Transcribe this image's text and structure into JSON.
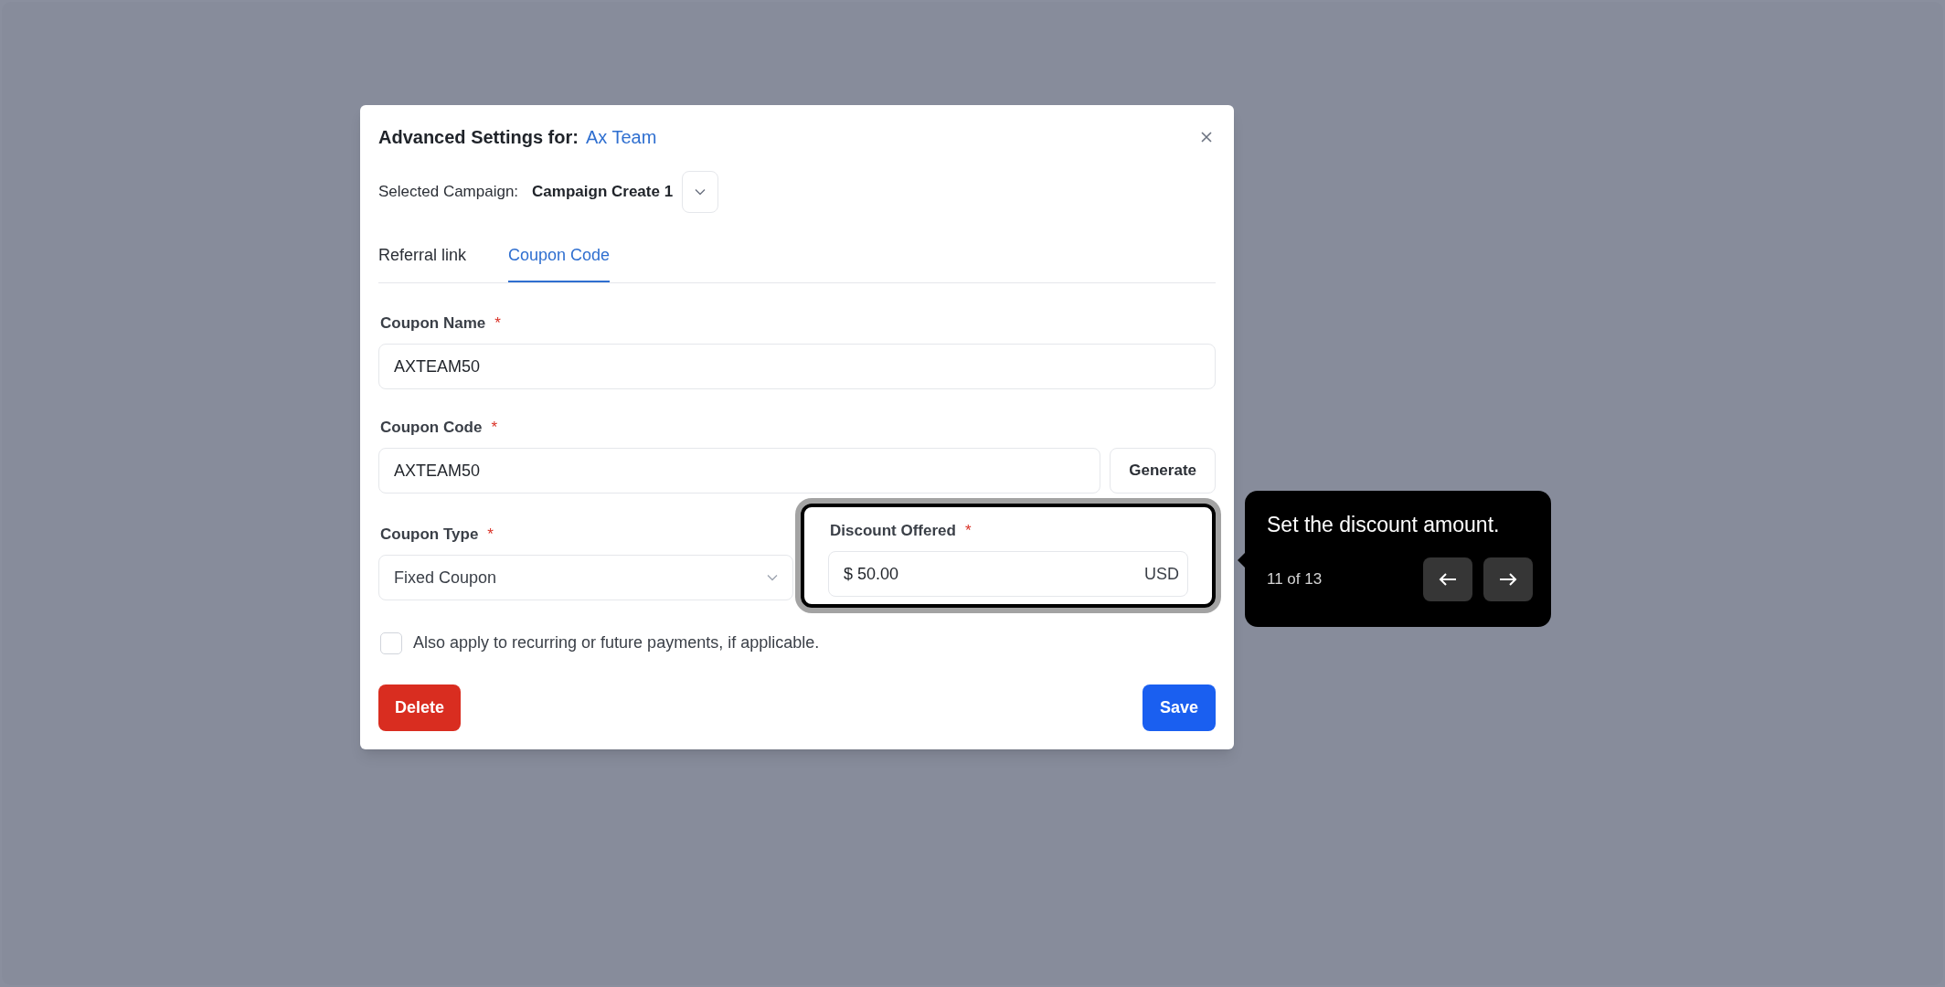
{
  "dialog": {
    "title": "Advanced Settings for:",
    "team": "Ax Team",
    "campaign_label": "Selected Campaign:",
    "campaign_value": "Campaign Create 1"
  },
  "tabs": [
    {
      "label": "Referral link",
      "selected": false
    },
    {
      "label": "Coupon Code",
      "selected": true
    }
  ],
  "form": {
    "coupon_name": {
      "label": "Coupon Name",
      "required_mark": "*",
      "value": "AXTEAM50"
    },
    "coupon_code": {
      "label": "Coupon Code",
      "required_mark": "*",
      "value": "AXTEAM50",
      "button": "Generate"
    },
    "coupon_type": {
      "label": "Coupon Type",
      "required_mark": "*",
      "value": "Fixed Coupon"
    },
    "discount": {
      "label": "Discount Offered",
      "required_mark": "*",
      "value": "$ 50.00",
      "suffix": "USD",
      "highlighted": true
    },
    "recurring": {
      "label": "Also apply to recurring or future payments, if applicable.",
      "checked": false
    }
  },
  "buttons": {
    "delete": "Delete",
    "save": "Save"
  },
  "tour": {
    "text": "Set the discount amount.",
    "step": "11 of 13"
  }
}
